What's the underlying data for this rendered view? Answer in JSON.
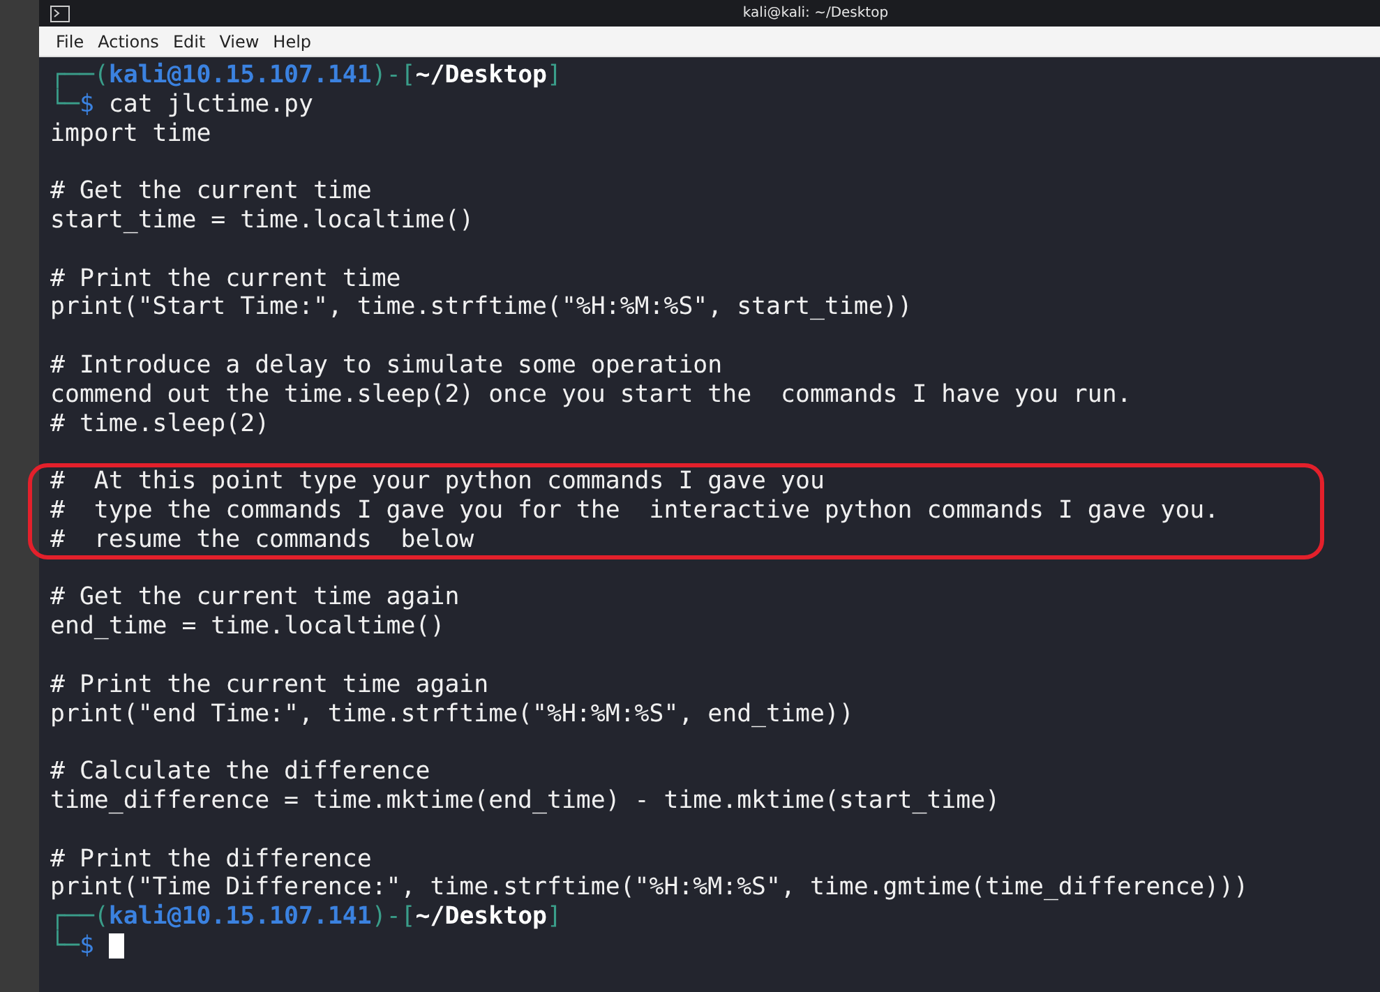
{
  "window": {
    "title": "kali@kali: ~/Desktop"
  },
  "menu": [
    "File",
    "Actions",
    "Edit",
    "View",
    "Help"
  ],
  "terminal": {
    "lines": [
      {
        "kind": "prompt",
        "frame_top": "┌──(",
        "user_host": "kali@10.15.107.141",
        "sep": ")-[",
        "path": "~/Desktop",
        "close": "]"
      },
      {
        "kind": "command",
        "frame_bottom": "└─",
        "symbol": "$",
        "text": "cat jlctime.py"
      },
      {
        "kind": "code",
        "text": "import time"
      },
      {
        "kind": "blank"
      },
      {
        "kind": "code",
        "text": "# Get the current time"
      },
      {
        "kind": "code",
        "text": "start_time = time.localtime()"
      },
      {
        "kind": "blank"
      },
      {
        "kind": "code",
        "text": "# Print the current time"
      },
      {
        "kind": "code",
        "text": "print(\"Start Time:\", time.strftime(\"%H:%M:%S\", start_time))"
      },
      {
        "kind": "blank"
      },
      {
        "kind": "code",
        "text": "# Introduce a delay to simulate some operation"
      },
      {
        "kind": "code",
        "text": "commend out the time.sleep(2) once you start the  commands I have you run."
      },
      {
        "kind": "code",
        "text": "# time.sleep(2)"
      },
      {
        "kind": "blank"
      },
      {
        "kind": "highlight",
        "lines": [
          "#  At this point type your python commands I gave you",
          "#  type the commands I gave you for the  interactive python commands I gave you.",
          "#  resume the commands  below"
        ]
      },
      {
        "kind": "blank"
      },
      {
        "kind": "code",
        "text": "# Get the current time again"
      },
      {
        "kind": "code",
        "text": "end_time = time.localtime()"
      },
      {
        "kind": "blank"
      },
      {
        "kind": "code",
        "text": "# Print the current time again"
      },
      {
        "kind": "code",
        "text": "print(\"end Time:\", time.strftime(\"%H:%M:%S\", end_time))"
      },
      {
        "kind": "blank"
      },
      {
        "kind": "code",
        "text": "# Calculate the difference"
      },
      {
        "kind": "code",
        "text": "time_difference = time.mktime(end_time) - time.mktime(start_time)"
      },
      {
        "kind": "blank"
      },
      {
        "kind": "code",
        "text": "# Print the difference"
      },
      {
        "kind": "code",
        "text": "print(\"Time Difference:\", time.strftime(\"%H:%M:%S\", time.gmtime(time_difference)))"
      },
      {
        "kind": "prompt",
        "frame_top": "┌──(",
        "user_host": "kali@10.15.107.141",
        "sep": ")-[",
        "path": "~/Desktop",
        "close": "]"
      },
      {
        "kind": "input",
        "frame_bottom": "└─",
        "symbol": "$",
        "cursor": true
      }
    ]
  }
}
